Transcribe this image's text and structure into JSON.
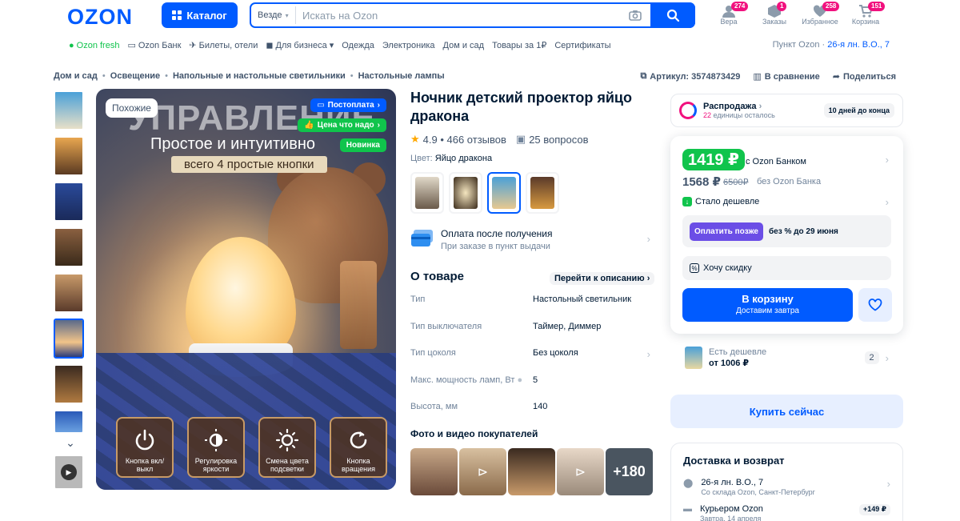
{
  "header": {
    "logo": "OZON",
    "catalog_label": "Каталог",
    "search_scope": "Везде",
    "search_placeholder": "Искать на Ozon",
    "icons": [
      {
        "label": "Вера",
        "badge": "274",
        "icon": "user-icon"
      },
      {
        "label": "Заказы",
        "badge": "1",
        "icon": "box-icon"
      },
      {
        "label": "Избранное",
        "badge": "258",
        "icon": "heart-icon"
      },
      {
        "label": "Корзина",
        "badge": "151",
        "icon": "cart-icon"
      }
    ]
  },
  "subnav": {
    "items": [
      "Ozon fresh",
      "Ozon Банк",
      "Билеты, отели",
      "Для бизнеса",
      "Одежда",
      "Электроника",
      "Дом и сад",
      "Товары за 1₽",
      "Сертификаты"
    ],
    "pickup_label": "Пункт Ozon ·",
    "pickup_address": "26-я лн. В.О., 7"
  },
  "breadcrumbs": [
    "Дом и сад",
    "Освещение",
    "Напольные и настольные светильники",
    "Настольные лампы"
  ],
  "meta": {
    "article": "Артикул: 3574873429",
    "compare": "В сравнение",
    "share": "Поделиться"
  },
  "image": {
    "similar_label": "Похожие",
    "tag_postoplata": "Постоплата",
    "tag_price": "Цена что надо",
    "tag_new": "Новинка",
    "heading": "УПРАВЛЕНИЕ",
    "subheading": "Простое и интуитивно",
    "banner": "всего 4 простые кнопки",
    "buttons": [
      {
        "label": "Кнопка вкл/выкл",
        "icon": "power-icon"
      },
      {
        "label": "Регулировка яркости",
        "icon": "brightness-icon"
      },
      {
        "label": "Смена цвета подсветки",
        "icon": "sun-icon"
      },
      {
        "label": "Кнопка вращения",
        "icon": "rotate-icon"
      }
    ]
  },
  "product": {
    "title": "Ночник детский проектор яйцо дракона",
    "rating": "4.9 • 466 отзывов",
    "questions": "25 вопросов",
    "color_label": "Цвет:",
    "color_value": "Яйцо дракона",
    "payment_title": "Оплата после получения",
    "payment_sub": "При заказе в пункт выдачи",
    "about_title": "О товаре",
    "goto_description": "Перейти к описанию",
    "specs": [
      {
        "k": "Тип",
        "v": "Настольный светильник"
      },
      {
        "k": "Тип выключателя",
        "v": "Таймер, Диммер"
      },
      {
        "k": "Тип цоколя",
        "v": "Без цоколя"
      },
      {
        "k": "Макс. мощность ламп, Вт",
        "v": "5"
      },
      {
        "k": "Высота, мм",
        "v": "140"
      }
    ],
    "photos_title": "Фото и видео покупателей",
    "photos_more": "+180"
  },
  "offer": {
    "sale_title": "Распродажа",
    "sale_remaining_count": "22",
    "sale_remaining_text": "единицы осталось",
    "sale_days": "10 дней до конца",
    "price_bank": "1419 ₽",
    "price_bank_label": "с Ozon Банком",
    "price_regular": "1568 ₽",
    "price_old": "6500₽",
    "price_regular_label": "без Ozon Банка",
    "cheaper_label": "Стало дешевле",
    "pay_later_btn": "Оплатить позже",
    "pay_later_label": "без % до 29 июня",
    "discount_label": "Хочу скидку",
    "cart_label": "В корзину",
    "cart_sub": "Доставим завтра",
    "cheaper_offer_label": "Есть дешевле",
    "cheaper_offer_price": "от 1006 ₽",
    "cheaper_offer_count": "2",
    "buy_now": "Купить сейчас"
  },
  "delivery": {
    "title": "Доставка и возврат",
    "rows": [
      {
        "title": "26-я лн. В.О., 7",
        "sub": "Со склада Ozon, Санкт-Петербург",
        "price": ""
      },
      {
        "title": "Курьером Ozon",
        "sub": "Завтра, 14 апреля",
        "price": "+149 ₽"
      }
    ]
  },
  "colors": {
    "brand": "#005bff",
    "accent_pink": "#f1117e",
    "green": "#10c44c"
  }
}
